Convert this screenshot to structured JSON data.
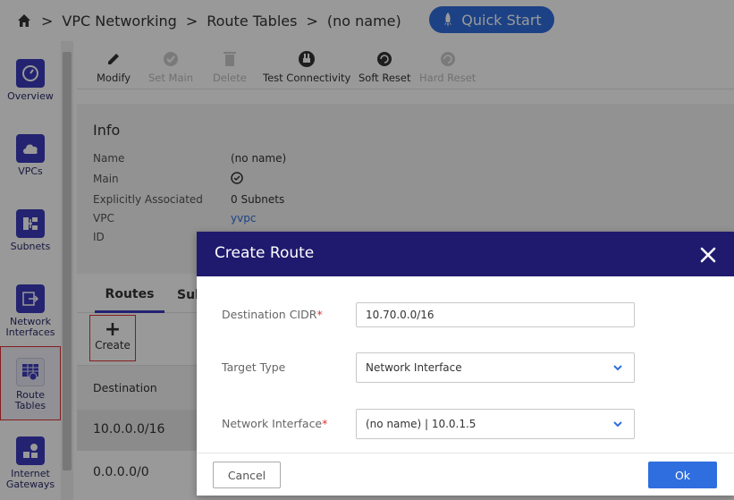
{
  "breadcrumb": {
    "items": [
      "VPC Networking",
      "Route Tables",
      "(no name)"
    ],
    "separator": ">"
  },
  "quickstart": {
    "label": "Quick Start"
  },
  "sidebar": {
    "items": [
      {
        "label": "Overview",
        "icon": "gauge-icon"
      },
      {
        "label": "VPCs",
        "icon": "cloud-icon"
      },
      {
        "label": "Subnets",
        "icon": "subnets-icon"
      },
      {
        "label": "Network Interfaces",
        "icon": "network-interface-icon"
      },
      {
        "label": "Route Tables",
        "icon": "route-table-icon"
      },
      {
        "label": "Internet Gateways",
        "icon": "internet-gateway-icon"
      }
    ]
  },
  "toolbar": {
    "modify": "Modify",
    "set_main": "Set Main",
    "delete": "Delete",
    "test_connectivity": "Test Connectivity",
    "soft_reset": "Soft Reset",
    "hard_reset": "Hard Reset"
  },
  "info": {
    "title": "Info",
    "name_label": "Name",
    "name_value": "(no name)",
    "main_label": "Main",
    "explicit_label": "Explicitly Associated",
    "explicit_value": "0 Subnets",
    "vpc_label": "VPC",
    "vpc_value": "yvpc",
    "id_label": "ID"
  },
  "tabs": {
    "routes": "Routes",
    "subnets": "Sub"
  },
  "routes": {
    "create_label": "Create",
    "column_destination": "Destination",
    "rows": [
      "10.0.0.0/16",
      "0.0.0.0/0"
    ]
  },
  "modal": {
    "title": "Create Route",
    "destination_label": "Destination CIDR",
    "destination_value": "10.70.0.0/16",
    "target_type_label": "Target Type",
    "target_type_value": "Network Interface",
    "network_interface_label": "Network Interface",
    "network_interface_value": "(no name) | 10.0.1.5",
    "required_mark": "*",
    "cancel": "Cancel",
    "ok": "Ok"
  },
  "colors": {
    "modal_header": "#1f1a6e",
    "primary": "#2f6ede",
    "required": "#d33333"
  }
}
